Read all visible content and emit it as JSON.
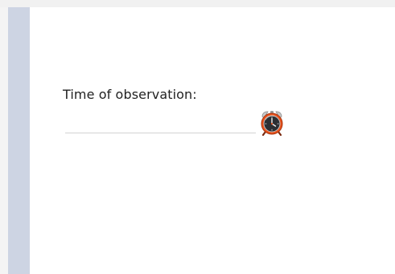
{
  "form": {
    "time_label": "Time of observation:",
    "time_value": "",
    "time_icon": "alarm-clock-icon"
  },
  "colors": {
    "side_rail": "#cdd4e3",
    "content_bg": "#ffffff",
    "input_underline": "#d3d3d3",
    "clock_body": "#e8521c"
  }
}
